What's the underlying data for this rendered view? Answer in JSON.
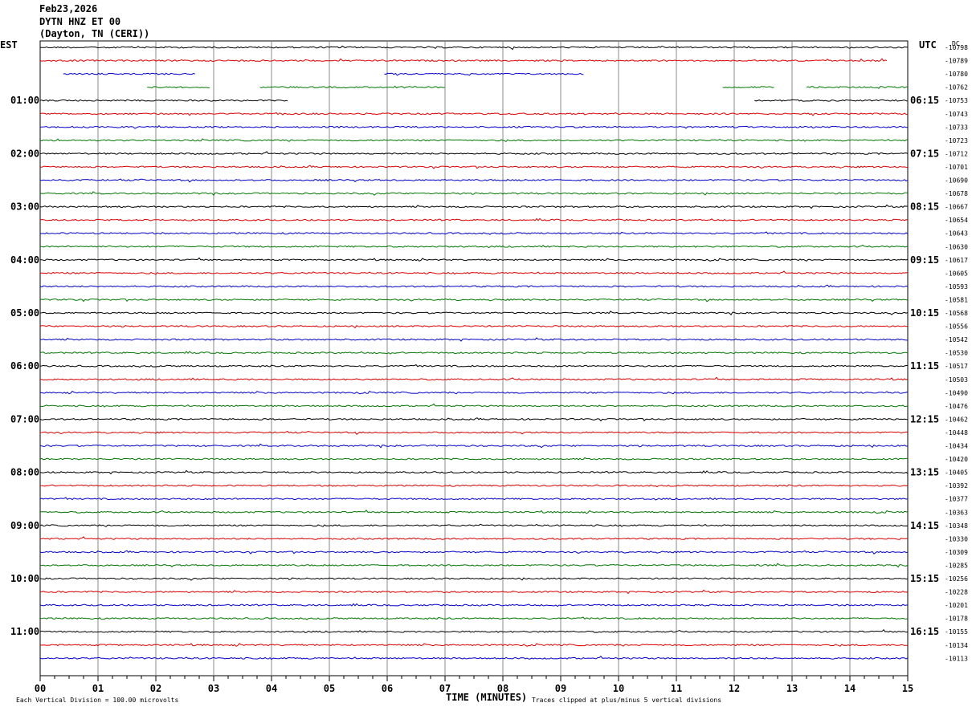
{
  "header": {
    "date": "Feb23,2026",
    "station": "DYTN HNZ ET 00",
    "location": "(Dayton, TN (CERI))"
  },
  "left_tz": "EST",
  "right_tz": "UTC",
  "dc_label": "DC",
  "footer": {
    "scale_note": "Each Vertical Division =  100.00 microvolts",
    "xlabel": "TIME (MINUTES)",
    "clip_note": "Traces clipped at plus/minus 5 vertical divisions"
  },
  "chart_data": {
    "type": "line",
    "title": "DYTN HNZ ET 00",
    "xlabel": "TIME (MINUTES)",
    "xlim": [
      0,
      15
    ],
    "x_ticks": [
      "00",
      "01",
      "02",
      "03",
      "04",
      "05",
      "06",
      "07",
      "08",
      "09",
      "10",
      "11",
      "12",
      "13",
      "14",
      "15"
    ],
    "grid": true,
    "trace_colors": [
      "#000000",
      "#dd0000",
      "#0000cc",
      "#007700"
    ],
    "left_hour_labels": [
      "01:00",
      "02:00",
      "03:00",
      "04:00",
      "05:00",
      "06:00",
      "07:00",
      "08:00",
      "09:00",
      "10:00",
      "11:00"
    ],
    "right_hour_labels": [
      "06:15",
      "07:15",
      "08:15",
      "09:15",
      "10:15",
      "11:15",
      "12:15",
      "13:15",
      "14:15",
      "15:15",
      "16:15"
    ],
    "dc_offsets": [
      "-10798",
      "-10789",
      "-10780",
      "-10762",
      "-10753",
      "-10743",
      "-10733",
      "-10723",
      "-10712",
      "-10701",
      "-10690",
      "-10678",
      "-10667",
      "-10654",
      "-10643",
      "-10630",
      "-10617",
      "-10605",
      "-10593",
      "-10581",
      "-10568",
      "-10556",
      "-10542",
      "-10530",
      "-10517",
      "-10503",
      "-10490",
      "-10476",
      "-10462",
      "-10448",
      "-10434",
      "-10420",
      "-10405",
      "-10392",
      "-10377",
      "-10363",
      "-10348",
      "-10330",
      "-10309",
      "-10285",
      "-10256",
      "-10228",
      "-10201",
      "-10178",
      "-10155",
      "-10134",
      "-10113"
    ],
    "traces": [
      {
        "row": 0,
        "segments": [
          [
            0,
            15
          ]
        ]
      },
      {
        "row": 1,
        "segments": [
          [
            0,
            14.65
          ]
        ]
      },
      {
        "row": 2,
        "segments": [
          [
            0.4,
            2.7
          ],
          [
            5.95,
            9.4
          ]
        ]
      },
      {
        "row": 3,
        "segments": [
          [
            1.85,
            2.95
          ],
          [
            3.8,
            7.0
          ],
          [
            11.8,
            12.7
          ],
          [
            13.25,
            15
          ]
        ]
      },
      {
        "row": 4,
        "segments": [
          [
            0,
            4.3
          ],
          [
            12.35,
            15
          ]
        ]
      }
    ]
  }
}
